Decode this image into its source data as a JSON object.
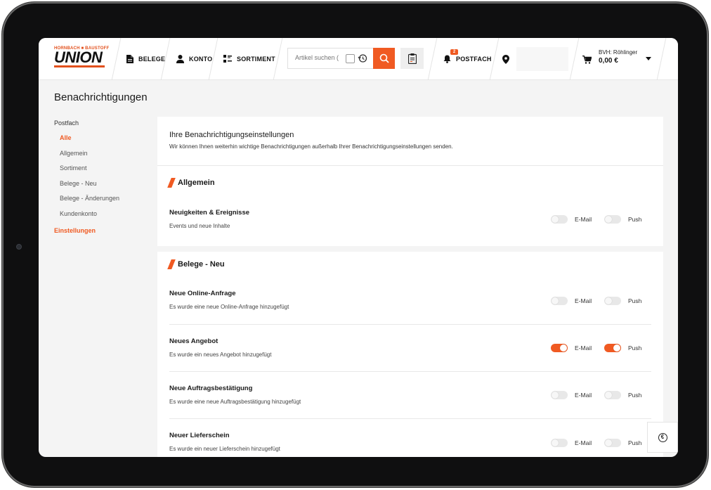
{
  "logo": {
    "top": "HORNBACH ■ BAUSTOFF",
    "main": "UNION"
  },
  "nav": {
    "belege": "BELEGE",
    "konto": "KONTO",
    "sortiment": "SORTIMENT",
    "postfach": "POSTFACH",
    "postfach_badge": "2"
  },
  "search": {
    "placeholder": "Artikel suchen ("
  },
  "cart": {
    "name": "BVH: Röhlinger",
    "amount": "0,00 €"
  },
  "page_title": "Benachrichtigungen",
  "sidebar": {
    "heading": "Postfach",
    "items": [
      {
        "label": "Alle",
        "active": true
      },
      {
        "label": "Allgemein"
      },
      {
        "label": "Sortiment"
      },
      {
        "label": "Belege - Neu"
      },
      {
        "label": "Belege - Änderungen"
      },
      {
        "label": "Kundenkonto"
      }
    ],
    "settings": "Einstellungen"
  },
  "intro": {
    "title": "Ihre Benachrichtigungseinstellungen",
    "text": "Wir können Ihnen weiterhin wichtige Benachrichtigungen außerhalb Ihrer Benachrichtigungseinstellungen senden."
  },
  "labels": {
    "email": "E-Mail",
    "push": "Push"
  },
  "sections": [
    {
      "title": "Allgemein",
      "rows": [
        {
          "title": "Neuigkeiten & Ereignisse",
          "desc": "Events und neue Inhalte",
          "email": false,
          "push": false
        }
      ]
    },
    {
      "title": "Belege - Neu",
      "rows": [
        {
          "title": "Neue Online-Anfrage",
          "desc": "Es wurde eine neue Online-Anfrage hinzugefügt",
          "email": false,
          "push": false
        },
        {
          "title": "Neues Angebot",
          "desc": "Es wurde ein neues Angebot hinzugefügt",
          "email": true,
          "push": true
        },
        {
          "title": "Neue Auftragsbestätigung",
          "desc": "Es wurde eine neue Auftragsbestätigung hinzugefügt",
          "email": false,
          "push": false
        },
        {
          "title": "Neuer Lieferschein",
          "desc": "Es wurde ein neuer Lieferschein hinzugefügt",
          "email": false,
          "push": false
        }
      ]
    }
  ],
  "colors": {
    "accent": "#f05a22",
    "toggle_off": "#e8e8e8"
  },
  "icons": [
    "document-icon",
    "user-icon",
    "grid-icon",
    "search-icon",
    "clipboard-icon",
    "bell-icon",
    "location-pin-icon",
    "cart-icon",
    "chevron-down-icon",
    "euro-icon",
    "history-icon"
  ]
}
